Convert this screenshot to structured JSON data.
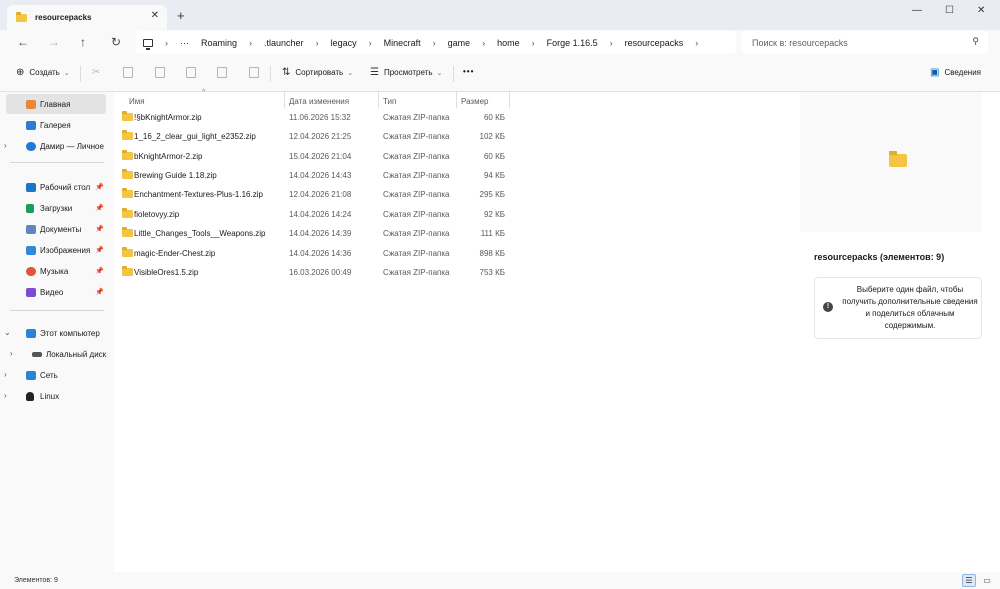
{
  "window": {
    "tab_title": "resourcepacks",
    "tab_close": "✕",
    "new_tab": "+",
    "minimize": "—",
    "maximize": "☐",
    "close": "✕"
  },
  "navigation": {
    "back": "←",
    "forward": "→",
    "up": "↑",
    "refresh": "↻",
    "more": "···",
    "breadcrumb": [
      "Roaming",
      ".tlauncher",
      "legacy",
      "Minecraft",
      "game",
      "home",
      "Forge 1.16.5",
      "resourcepacks"
    ],
    "separator": "›",
    "search_placeholder": "Поиск в: resourcepacks"
  },
  "toolbar": {
    "create_label": "Создать",
    "sort_label": "Сортировать",
    "view_label": "Просмотреть",
    "more_label": "•••",
    "details_label": "Сведения"
  },
  "sidebar": {
    "items": [
      {
        "label": "Главная",
        "icon": "home-icon",
        "color": "#e9863a"
      },
      {
        "label": "Галерея",
        "icon": "gallery-icon",
        "color": "#2e7bd6"
      },
      {
        "label": "Дамир — Личное",
        "icon": "onedrive-icon",
        "color": "#1f7ad6"
      },
      {
        "label": "Рабочий стол",
        "icon": "desktop-icon",
        "color": "#1e74c9"
      },
      {
        "label": "Загрузки",
        "icon": "downloads-icon",
        "color": "#1a9c5a"
      },
      {
        "label": "Документы",
        "icon": "documents-icon",
        "color": "#5b87c2"
      },
      {
        "label": "Изображения",
        "icon": "pictures-icon",
        "color": "#2f8ad8"
      },
      {
        "label": "Музыка",
        "icon": "music-icon",
        "color": "#e0533d"
      },
      {
        "label": "Видео",
        "icon": "videos-icon",
        "color": "#7b4bd0"
      },
      {
        "label": "Этот компьютер",
        "icon": "this-pc-icon",
        "color": "#2a84d6"
      },
      {
        "label": "Локальный диск",
        "icon": "local-disk-icon",
        "color": "#555555"
      },
      {
        "label": "Сеть",
        "icon": "network-icon",
        "color": "#2a84d6"
      },
      {
        "label": "Linux",
        "icon": "linux-icon",
        "color": "#222222"
      }
    ]
  },
  "columns": {
    "name": "Имя",
    "date": "Дата изменения",
    "type": "Тип",
    "size": "Размер"
  },
  "files": [
    {
      "name": "!§bKnightArmor.zip",
      "date": "11.06.2026 15:32",
      "type": "Сжатая ZIP-папка",
      "size": "60 КБ"
    },
    {
      "name": "1_16_2_clear_gui_light_e2352.zip",
      "date": "12.04.2026 21:25",
      "type": "Сжатая ZIP-папка",
      "size": "102 КБ"
    },
    {
      "name": "bKnightArmor-2.zip",
      "date": "15.04.2026 21:04",
      "type": "Сжатая ZIP-папка",
      "size": "60 КБ"
    },
    {
      "name": "Brewing Guide 1.18.zip",
      "date": "14.04.2026 14:43",
      "type": "Сжатая ZIP-папка",
      "size": "94 КБ"
    },
    {
      "name": "Enchantment-Textures-Plus-1.16.zip",
      "date": "12.04.2026 21:08",
      "type": "Сжатая ZIP-папка",
      "size": "295 КБ"
    },
    {
      "name": "fioletovyy.zip",
      "date": "14.04.2026 14:24",
      "type": "Сжатая ZIP-папка",
      "size": "92 КБ"
    },
    {
      "name": "Little_Changes_Tools__Weapons.zip",
      "date": "14.04.2026 14:39",
      "type": "Сжатая ZIP-папка",
      "size": "111 КБ"
    },
    {
      "name": "magic-Ender-Chest.zip",
      "date": "14.04.2026 14:36",
      "type": "Сжатая ZIP-папка",
      "size": "898 КБ"
    },
    {
      "name": "VisibleOres1.5.zip",
      "date": "16.03.2026 00:49",
      "type": "Сжатая ZIP-папка",
      "size": "753 КБ"
    }
  ],
  "details": {
    "title": "resourcepacks (элементов: 9)",
    "info": "Выберите один файл, чтобы получить дополнительные сведения и поделиться облачным содержимым."
  },
  "status": {
    "count": "Элементов: 9"
  }
}
